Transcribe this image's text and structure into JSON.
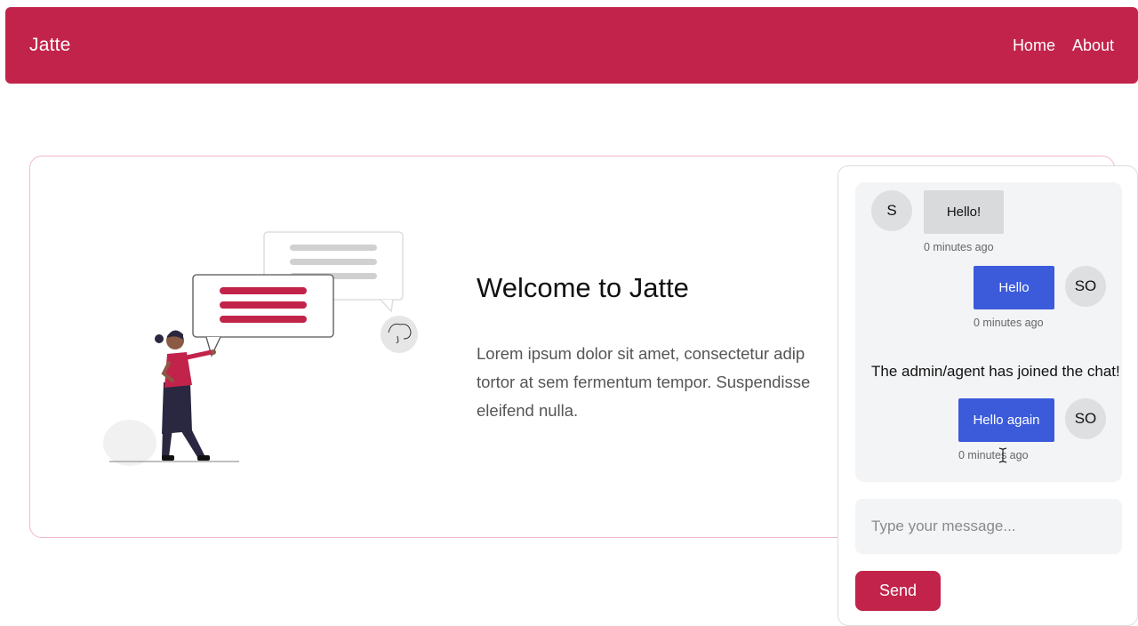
{
  "nav": {
    "brand": "Jatte",
    "links": [
      {
        "label": "Home"
      },
      {
        "label": "About"
      }
    ]
  },
  "hero": {
    "title": "Welcome to Jatte",
    "text_lines": [
      "Lorem ipsum dolor sit amet, consectetur adip",
      "tortor at sem fermentum tempor. Suspendisse",
      "eleifend nulla."
    ]
  },
  "chat": {
    "messages": [
      {
        "avatar": "S",
        "text": "Hello!",
        "time": "0 minutes ago",
        "direction": "incoming"
      },
      {
        "avatar": "SO",
        "text": "Hello",
        "time": "0 minutes ago",
        "direction": "outgoing"
      },
      {
        "avatar": "SO",
        "text": "Hello again",
        "time": "0 minutes ago",
        "direction": "outgoing"
      }
    ],
    "system_message": "The admin/agent has joined the chat!",
    "input_placeholder": "Type your message...",
    "send_label": "Send"
  },
  "colors": {
    "brand": "#c2234a",
    "outgoing_bubble": "#3b5bdb",
    "incoming_bubble": "#d9dadc"
  },
  "icons": [
    "person-illustration",
    "speech-bubble-icon",
    "cursor-ibeam-icon"
  ]
}
